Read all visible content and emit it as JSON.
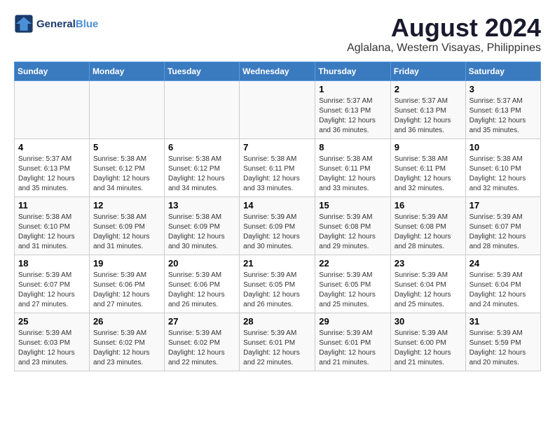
{
  "header": {
    "logo_line1": "General",
    "logo_line2": "Blue",
    "month_title": "August 2024",
    "location": "Aglalana, Western Visayas, Philippines"
  },
  "weekdays": [
    "Sunday",
    "Monday",
    "Tuesday",
    "Wednesday",
    "Thursday",
    "Friday",
    "Saturday"
  ],
  "weeks": [
    [
      {
        "day": "",
        "info": ""
      },
      {
        "day": "",
        "info": ""
      },
      {
        "day": "",
        "info": ""
      },
      {
        "day": "",
        "info": ""
      },
      {
        "day": "1",
        "info": "Sunrise: 5:37 AM\nSunset: 6:13 PM\nDaylight: 12 hours\nand 36 minutes."
      },
      {
        "day": "2",
        "info": "Sunrise: 5:37 AM\nSunset: 6:13 PM\nDaylight: 12 hours\nand 36 minutes."
      },
      {
        "day": "3",
        "info": "Sunrise: 5:37 AM\nSunset: 6:13 PM\nDaylight: 12 hours\nand 35 minutes."
      }
    ],
    [
      {
        "day": "4",
        "info": "Sunrise: 5:37 AM\nSunset: 6:13 PM\nDaylight: 12 hours\nand 35 minutes."
      },
      {
        "day": "5",
        "info": "Sunrise: 5:38 AM\nSunset: 6:12 PM\nDaylight: 12 hours\nand 34 minutes."
      },
      {
        "day": "6",
        "info": "Sunrise: 5:38 AM\nSunset: 6:12 PM\nDaylight: 12 hours\nand 34 minutes."
      },
      {
        "day": "7",
        "info": "Sunrise: 5:38 AM\nSunset: 6:11 PM\nDaylight: 12 hours\nand 33 minutes."
      },
      {
        "day": "8",
        "info": "Sunrise: 5:38 AM\nSunset: 6:11 PM\nDaylight: 12 hours\nand 33 minutes."
      },
      {
        "day": "9",
        "info": "Sunrise: 5:38 AM\nSunset: 6:11 PM\nDaylight: 12 hours\nand 32 minutes."
      },
      {
        "day": "10",
        "info": "Sunrise: 5:38 AM\nSunset: 6:10 PM\nDaylight: 12 hours\nand 32 minutes."
      }
    ],
    [
      {
        "day": "11",
        "info": "Sunrise: 5:38 AM\nSunset: 6:10 PM\nDaylight: 12 hours\nand 31 minutes."
      },
      {
        "day": "12",
        "info": "Sunrise: 5:38 AM\nSunset: 6:09 PM\nDaylight: 12 hours\nand 31 minutes."
      },
      {
        "day": "13",
        "info": "Sunrise: 5:38 AM\nSunset: 6:09 PM\nDaylight: 12 hours\nand 30 minutes."
      },
      {
        "day": "14",
        "info": "Sunrise: 5:39 AM\nSunset: 6:09 PM\nDaylight: 12 hours\nand 30 minutes."
      },
      {
        "day": "15",
        "info": "Sunrise: 5:39 AM\nSunset: 6:08 PM\nDaylight: 12 hours\nand 29 minutes."
      },
      {
        "day": "16",
        "info": "Sunrise: 5:39 AM\nSunset: 6:08 PM\nDaylight: 12 hours\nand 28 minutes."
      },
      {
        "day": "17",
        "info": "Sunrise: 5:39 AM\nSunset: 6:07 PM\nDaylight: 12 hours\nand 28 minutes."
      }
    ],
    [
      {
        "day": "18",
        "info": "Sunrise: 5:39 AM\nSunset: 6:07 PM\nDaylight: 12 hours\nand 27 minutes."
      },
      {
        "day": "19",
        "info": "Sunrise: 5:39 AM\nSunset: 6:06 PM\nDaylight: 12 hours\nand 27 minutes."
      },
      {
        "day": "20",
        "info": "Sunrise: 5:39 AM\nSunset: 6:06 PM\nDaylight: 12 hours\nand 26 minutes."
      },
      {
        "day": "21",
        "info": "Sunrise: 5:39 AM\nSunset: 6:05 PM\nDaylight: 12 hours\nand 26 minutes."
      },
      {
        "day": "22",
        "info": "Sunrise: 5:39 AM\nSunset: 6:05 PM\nDaylight: 12 hours\nand 25 minutes."
      },
      {
        "day": "23",
        "info": "Sunrise: 5:39 AM\nSunset: 6:04 PM\nDaylight: 12 hours\nand 25 minutes."
      },
      {
        "day": "24",
        "info": "Sunrise: 5:39 AM\nSunset: 6:04 PM\nDaylight: 12 hours\nand 24 minutes."
      }
    ],
    [
      {
        "day": "25",
        "info": "Sunrise: 5:39 AM\nSunset: 6:03 PM\nDaylight: 12 hours\nand 23 minutes."
      },
      {
        "day": "26",
        "info": "Sunrise: 5:39 AM\nSunset: 6:02 PM\nDaylight: 12 hours\nand 23 minutes."
      },
      {
        "day": "27",
        "info": "Sunrise: 5:39 AM\nSunset: 6:02 PM\nDaylight: 12 hours\nand 22 minutes."
      },
      {
        "day": "28",
        "info": "Sunrise: 5:39 AM\nSunset: 6:01 PM\nDaylight: 12 hours\nand 22 minutes."
      },
      {
        "day": "29",
        "info": "Sunrise: 5:39 AM\nSunset: 6:01 PM\nDaylight: 12 hours\nand 21 minutes."
      },
      {
        "day": "30",
        "info": "Sunrise: 5:39 AM\nSunset: 6:00 PM\nDaylight: 12 hours\nand 21 minutes."
      },
      {
        "day": "31",
        "info": "Sunrise: 5:39 AM\nSunset: 5:59 PM\nDaylight: 12 hours\nand 20 minutes."
      }
    ]
  ]
}
